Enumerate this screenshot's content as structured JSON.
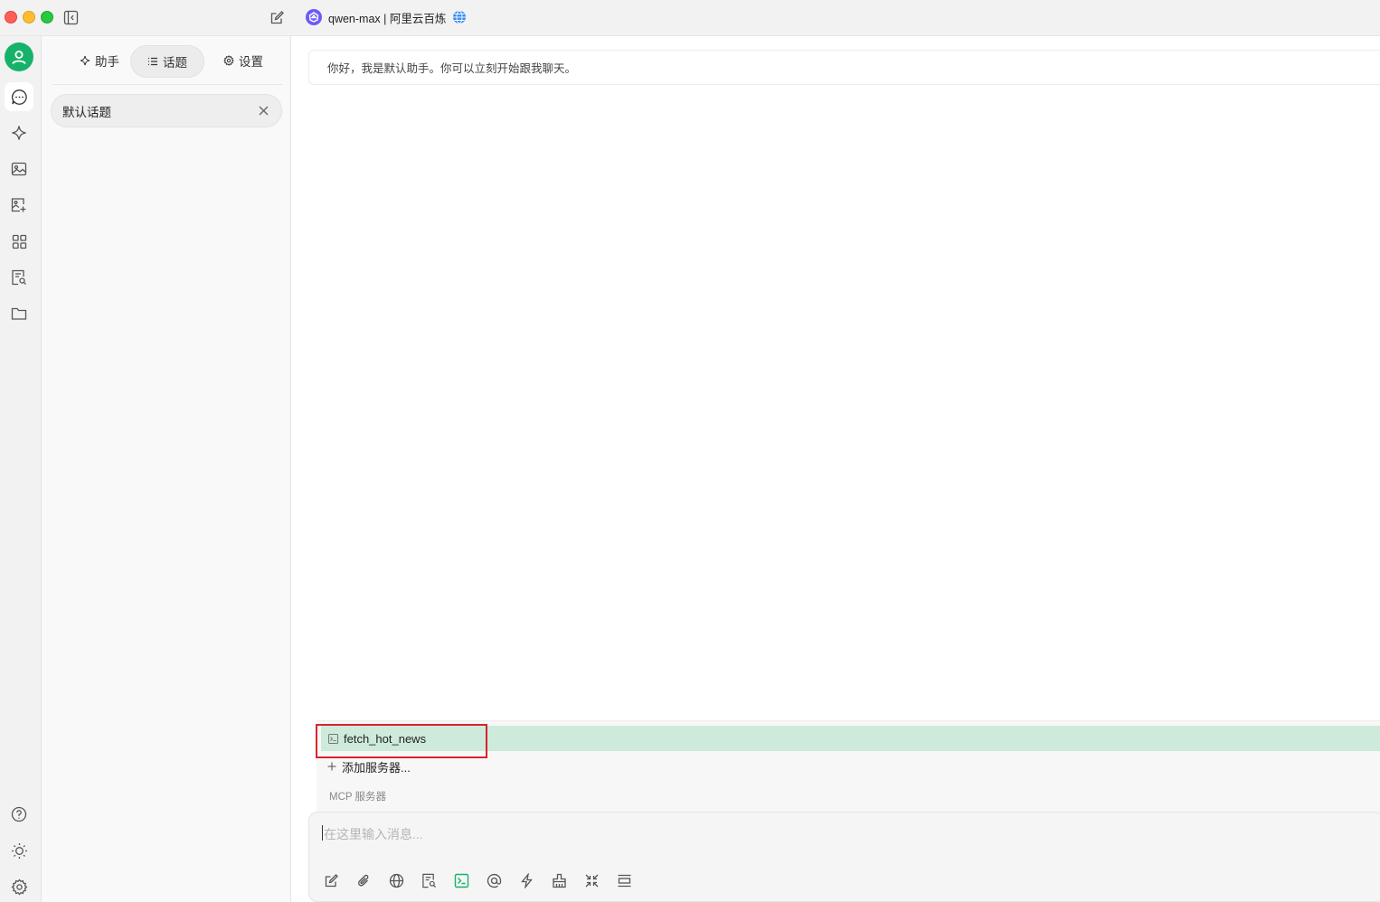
{
  "window": {
    "model_title": "qwen-max | 阿里云百炼"
  },
  "nav": {
    "items": [
      {
        "name": "chat",
        "icon": "chat-bubble-icon",
        "active": true
      },
      {
        "name": "assistants",
        "icon": "sparkle-icon"
      },
      {
        "name": "paintings",
        "icon": "image-icon"
      },
      {
        "name": "agents",
        "icon": "image-add-icon"
      },
      {
        "name": "apps",
        "icon": "grid-icon"
      },
      {
        "name": "knowledge",
        "icon": "document-search-icon"
      },
      {
        "name": "files",
        "icon": "folder-icon"
      }
    ],
    "bottom": [
      {
        "name": "help",
        "icon": "help-circle-icon"
      },
      {
        "name": "theme",
        "icon": "sun-icon"
      },
      {
        "name": "settings",
        "icon": "gear-icon"
      }
    ]
  },
  "sidebar": {
    "tabs": [
      {
        "label": "助手",
        "icon": "sparkle-icon",
        "active": false
      },
      {
        "label": "话题",
        "icon": "list-icon",
        "active": true
      },
      {
        "label": "设置",
        "icon": "gear-icon",
        "active": false
      }
    ],
    "topic": {
      "label": "默认话题"
    }
  },
  "chat": {
    "welcome_message": "你好，我是默认助手。你可以立刻开始跟我聊天。"
  },
  "mcp": {
    "servers": [
      {
        "name": "fetch_hot_news",
        "active": true
      }
    ],
    "add_label": "添加服务器...",
    "section_label": "MCP 服务器"
  },
  "composer": {
    "placeholder": "在这里输入消息...",
    "tools": [
      "new-topic-icon",
      "attachment-icon",
      "web-search-icon",
      "knowledge-base-icon",
      "mcp-terminal-icon",
      "mention-icon",
      "quick-phrase-icon",
      "clear-icon",
      "collapse-icon",
      "expand-input-icon"
    ]
  },
  "colors": {
    "accent": "#17b26a",
    "mcp_selected_bg": "#cdeadb",
    "highlight": "#d9232d"
  }
}
